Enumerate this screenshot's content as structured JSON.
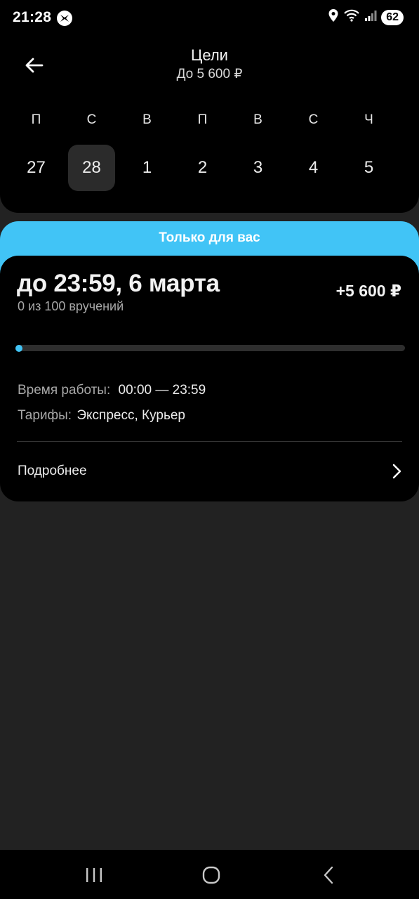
{
  "status_bar": {
    "time": "21:28",
    "battery": "62"
  },
  "header": {
    "title": "Цели",
    "subtitle": "До 5 600 ₽"
  },
  "days": [
    {
      "letter": "П",
      "number": "27",
      "selected": false
    },
    {
      "letter": "С",
      "number": "28",
      "selected": true
    },
    {
      "letter": "В",
      "number": "1",
      "selected": false
    },
    {
      "letter": "П",
      "number": "2",
      "selected": false
    },
    {
      "letter": "В",
      "number": "3",
      "selected": false
    },
    {
      "letter": "С",
      "number": "4",
      "selected": false
    },
    {
      "letter": "Ч",
      "number": "5",
      "selected": false
    }
  ],
  "offer": {
    "banner": "Только для вас",
    "deadline": "до 23:59, 6 марта",
    "progress_text": "0 из 100 вручений",
    "progress_fraction": 0.0,
    "reward": "+5 600 ₽",
    "work_time_label": "Время работы:",
    "work_time_value": "00:00 — 23:59",
    "tariffs_label": "Тарифы:",
    "tariffs_value": "Экспресс, Курьер",
    "more_label": "Подробнее"
  },
  "colors": {
    "accent": "#41c4f6",
    "background": "#222222",
    "card": "#000000"
  },
  "icons": {
    "back": "arrow-left-icon",
    "more": "chevron-right-icon",
    "nav_recent": "recent-apps-icon",
    "nav_home": "home-icon",
    "nav_back": "back-icon"
  }
}
